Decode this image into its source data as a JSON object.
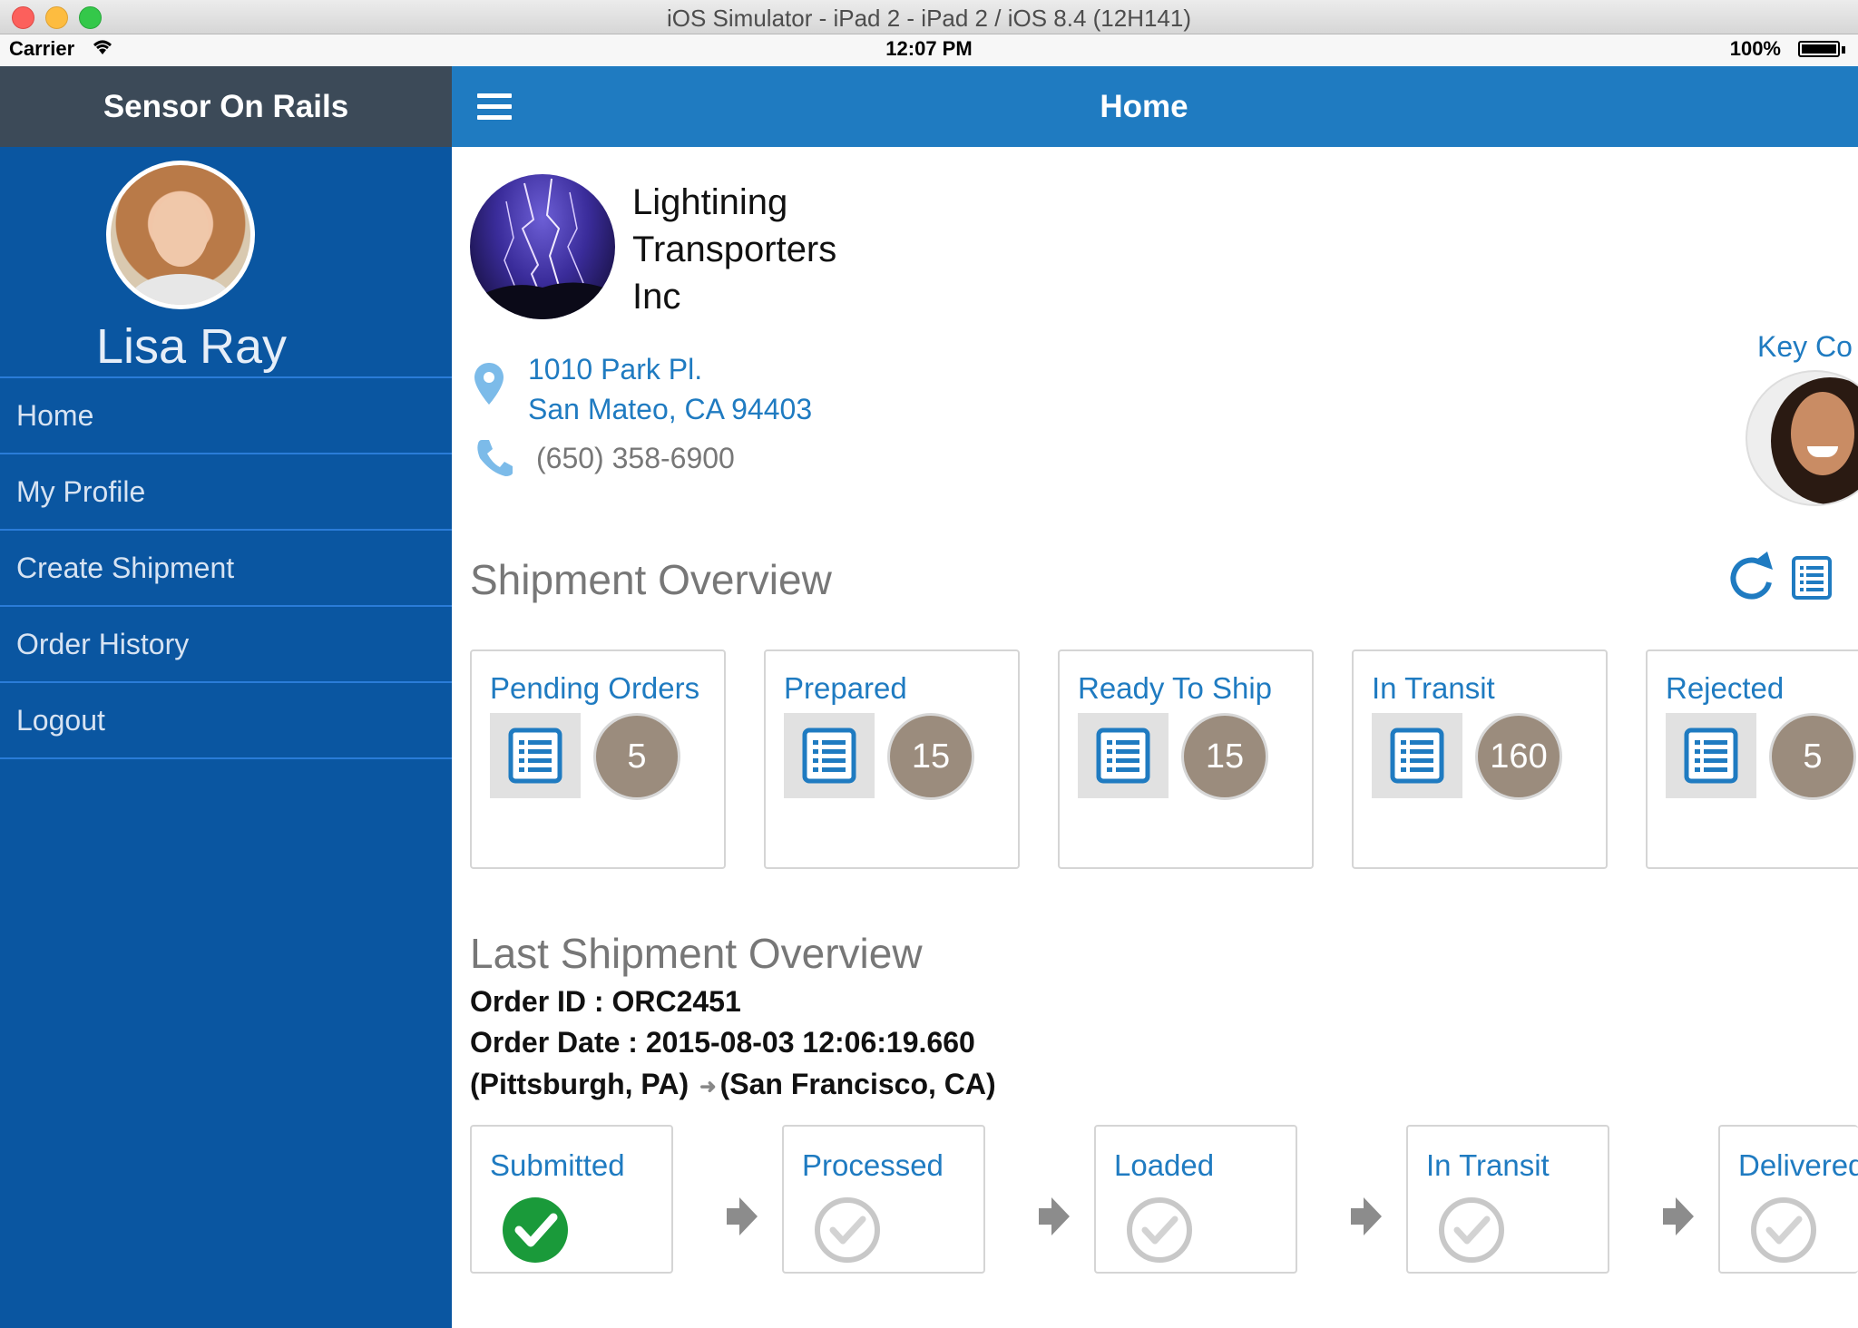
{
  "window": {
    "title": "iOS Simulator - iPad 2 - iPad 2 / iOS 8.4 (12H141)"
  },
  "status_bar": {
    "carrier": "Carrier",
    "time": "12:07 PM",
    "battery": "100%"
  },
  "sidebar": {
    "app_title": "Sensor On Rails",
    "user_name": "Lisa Ray",
    "items": [
      {
        "label": "Home"
      },
      {
        "label": "My Profile"
      },
      {
        "label": "Create Shipment"
      },
      {
        "label": "Order History"
      },
      {
        "label": "Logout"
      }
    ]
  },
  "header": {
    "title": "Home"
  },
  "company": {
    "name_line1": "Lightining",
    "name_line2": "Transporters",
    "name_line3": "Inc",
    "address_line1": "1010 Park Pl.",
    "address_line2": "San Mateo, CA 94403",
    "phone": "(650) 358-6900",
    "key_contact_label": "Key Co"
  },
  "shipment_overview": {
    "title": "Shipment Overview",
    "cards": [
      {
        "label": "Pending Orders",
        "count": "5"
      },
      {
        "label": "Prepared",
        "count": "15"
      },
      {
        "label": "Ready To Ship",
        "count": "15"
      },
      {
        "label": "In Transit",
        "count": "160"
      },
      {
        "label": "Rejected",
        "count": "5"
      }
    ]
  },
  "last_shipment": {
    "title": "Last Shipment Overview",
    "order_id": "Order ID : ORC2451",
    "order_date": "Order Date : 2015-08-03 12:06:19.660",
    "origin": "(Pittsburgh, PA)",
    "destination": "(San Francisco, CA)",
    "steps": [
      {
        "label": "Submitted",
        "completed": true
      },
      {
        "label": "Processed",
        "completed": false
      },
      {
        "label": "Loaded",
        "completed": false
      },
      {
        "label": "In Transit",
        "completed": false
      },
      {
        "label": "Delivered",
        "completed": false
      }
    ]
  },
  "colors": {
    "accent": "#1f7bc1",
    "sidebar_bg": "#0a56a1",
    "sidebar_header": "#3c4a58",
    "badge": "#9b8c7d",
    "success": "#1a9a3a"
  }
}
